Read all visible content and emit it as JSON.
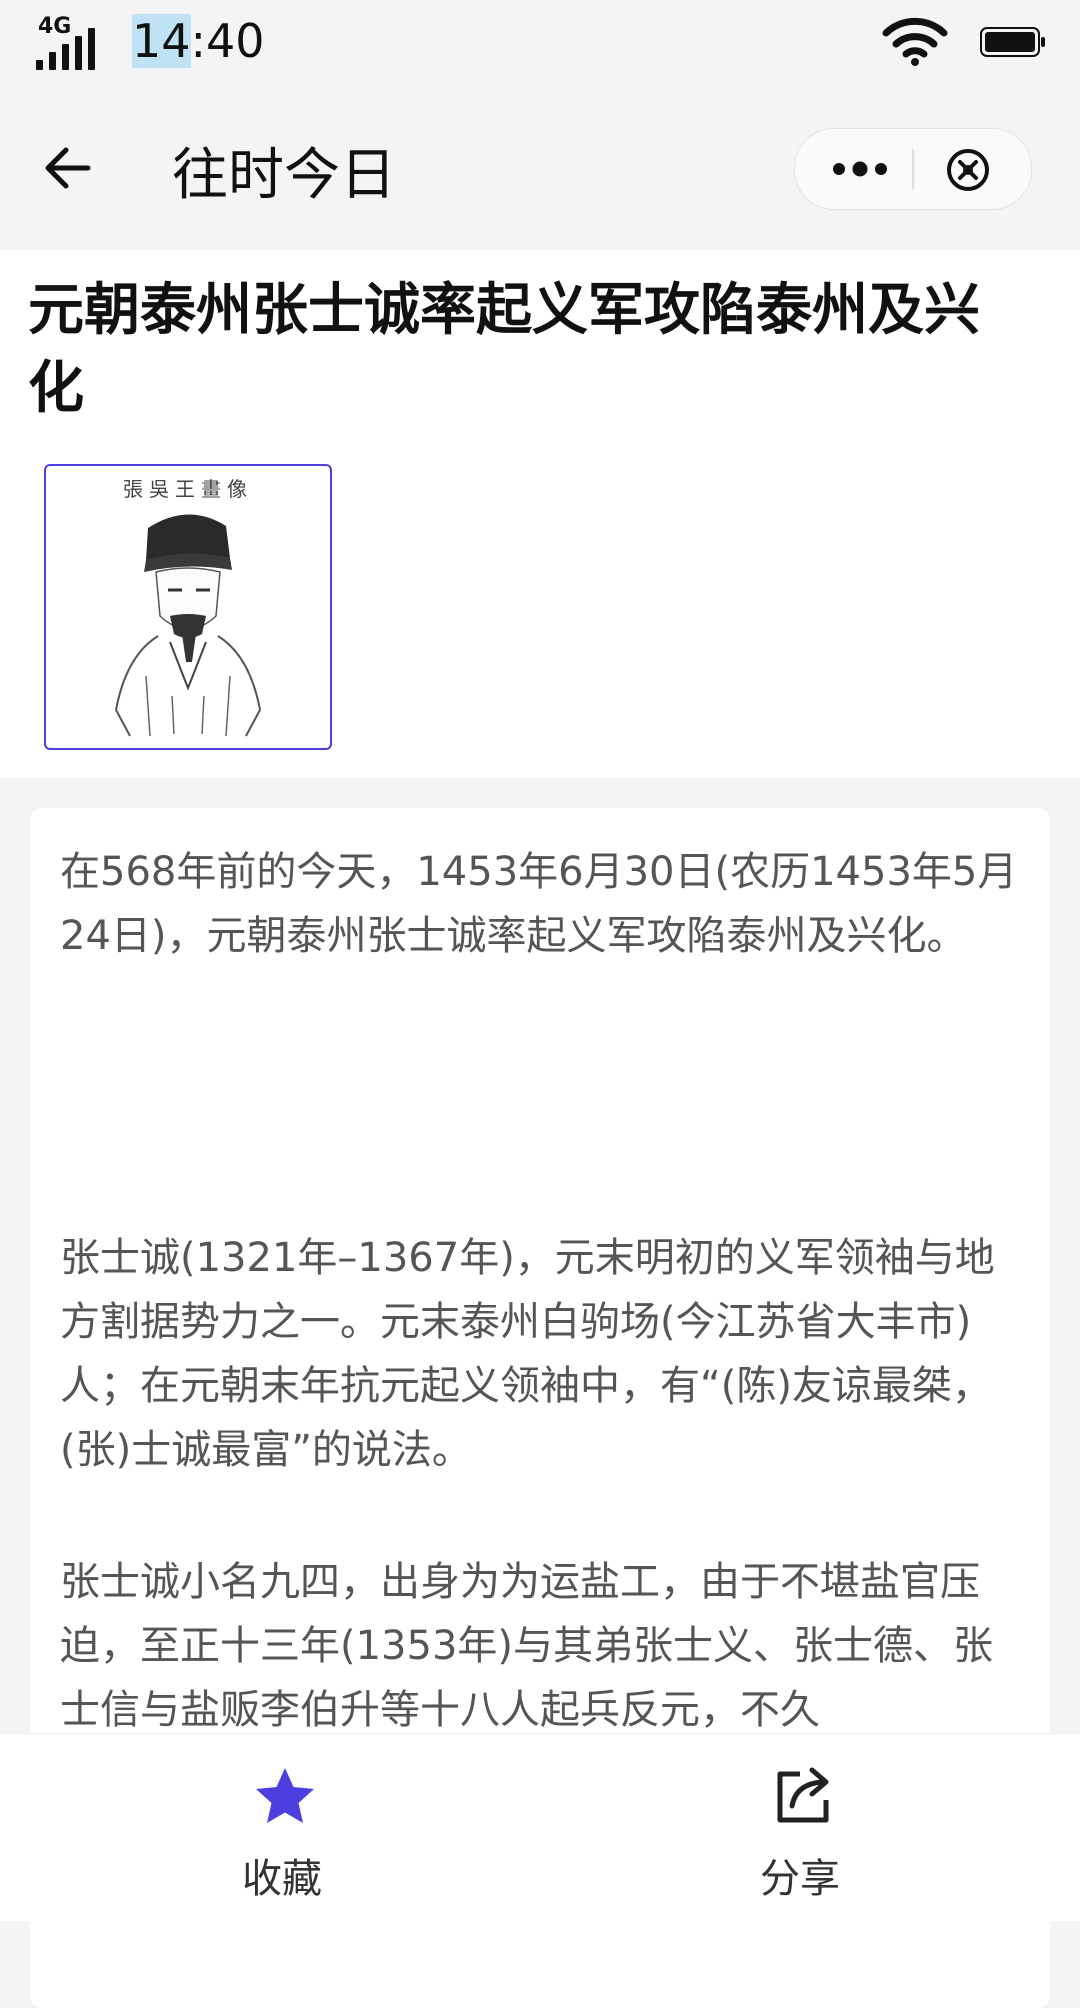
{
  "status_bar": {
    "network": "4G",
    "time_highlight": "14",
    "time_rest": ":40"
  },
  "nav": {
    "title": "往时今日"
  },
  "article": {
    "title": "元朝泰州张士诚率起义军攻陷泰州及兴化",
    "portrait_caption": "張吳王畫像",
    "paragraphs": [
      "在568年前的今天，1453年6月30日(农历1453年5月24日)，元朝泰州张士诚率起义军攻陷泰州及兴化。",
      "张士诚(1321年–1367年)，元末明初的义军领袖与地方割据势力之一。元末泰州白驹场(今江苏省大丰市)人；在元朝末年抗元起义领袖中，有“(陈)友谅最桀，(张)士诚最富”的说法。",
      "张士诚小名九四，出身为为运盐工，由于不堪盐官压迫，至正十三年(1353年)与其弟张士义、张士德、张士信与盐贩李伯升等十八人起兵反元，不久"
    ]
  },
  "bottom_bar": {
    "favorite_label": "收藏",
    "share_label": "分享"
  },
  "colors": {
    "accent": "#4b3fe0",
    "page_bg": "#f4f4f6",
    "body_text": "#555555"
  },
  "icons": {
    "back": "arrow-left-icon",
    "more": "more-dots-icon",
    "close": "close-circle-icon",
    "favorite": "star-icon",
    "share": "share-icon"
  }
}
